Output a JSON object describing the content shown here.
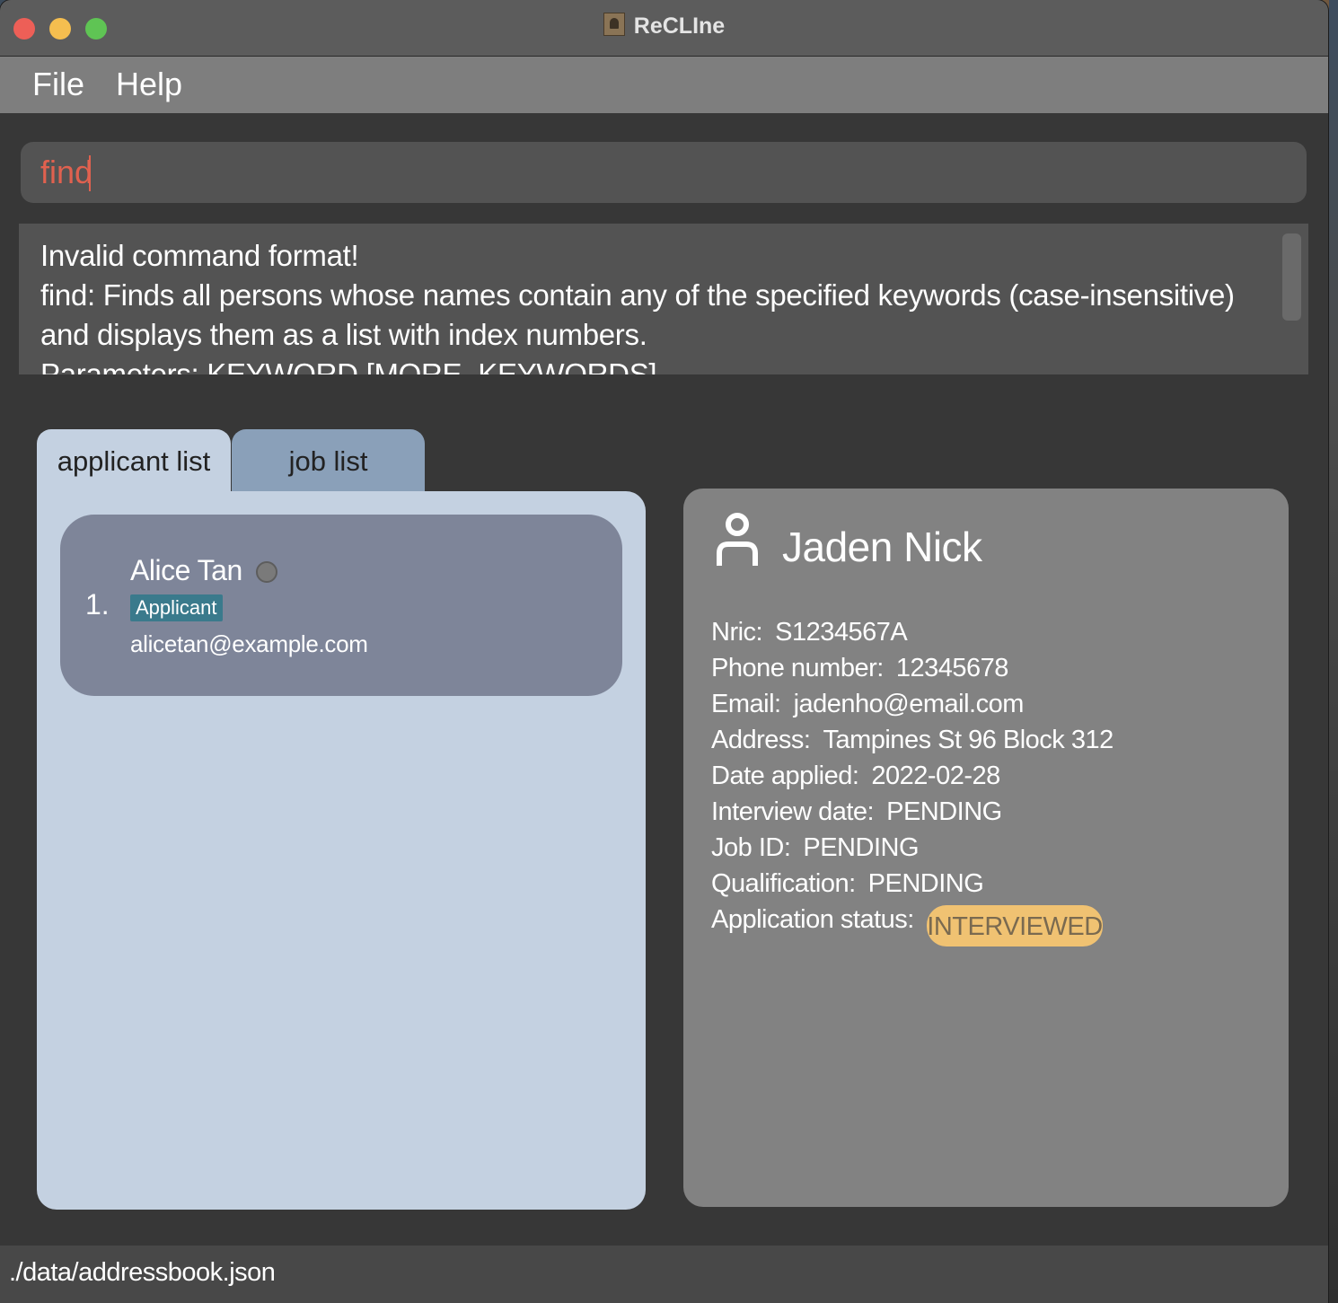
{
  "window": {
    "title": "ReCLIne"
  },
  "menu": {
    "file": "File",
    "help": "Help"
  },
  "command": {
    "value": "find"
  },
  "result": {
    "text": "Invalid command format!\nfind: Finds all persons whose names contain any of the specified keywords (case-insensitive) and displays them as a list with index numbers.\nParameters: KEYWORD [MORE_KEYWORDS]..."
  },
  "tabs": [
    {
      "label": "applicant list",
      "active": true
    },
    {
      "label": "job list",
      "active": false
    }
  ],
  "applicants": [
    {
      "index": "1.",
      "name": "Alice Tan",
      "tag": "Applicant",
      "email": "alicetan@example.com"
    }
  ],
  "detail": {
    "icon": "person-icon",
    "name": "Jaden Nick",
    "fields": [
      {
        "label": "Nric:",
        "value": "S1234567A"
      },
      {
        "label": "Phone number:",
        "value": "12345678"
      },
      {
        "label": "Email:",
        "value": "jadenho@email.com"
      },
      {
        "label": "Address:",
        "value": "Tampines St 96 Block 312"
      },
      {
        "label": "Date applied:",
        "value": "2022-02-28"
      },
      {
        "label": "Interview date:",
        "value": "PENDING"
      },
      {
        "label": "Job ID:",
        "value": "PENDING"
      },
      {
        "label": "Qualification:",
        "value": "PENDING"
      }
    ],
    "status_label": "Application status:",
    "status_value": "INTERVIEWED",
    "status_color": "#f0c272"
  },
  "statusbar": {
    "path": "./data/addressbook.json"
  },
  "colors": {
    "command_text": "#e0614f",
    "tag_bg": "#3a7a8c",
    "list_bg": "#c4d1e1",
    "card_bg": "#7e8599"
  }
}
